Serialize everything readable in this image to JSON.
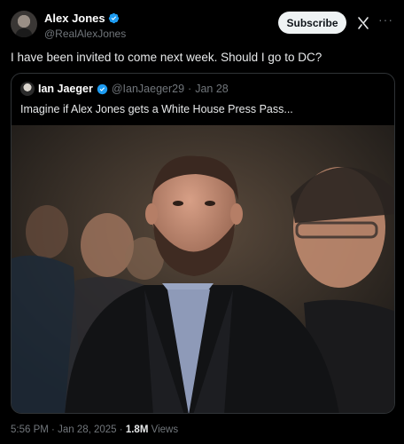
{
  "author": {
    "display_name": "Alex Jones",
    "handle": "@RealAlexJones"
  },
  "actions": {
    "subscribe_label": "Subscribe",
    "more_label": "···"
  },
  "tweet": {
    "text": "I have been invited to come next week. Should I go to DC?"
  },
  "quote": {
    "display_name": "Ian Jaeger",
    "handle": "@IanJaeger29",
    "separator": "·",
    "date": "Jan 28",
    "text": "Imagine if Alex Jones gets a White House Press Pass..."
  },
  "footer": {
    "time": "5:56 PM",
    "separator": "·",
    "date": "Jan 28, 2025",
    "separator2": "·",
    "views_count": "1.8M",
    "views_label": "Views"
  },
  "colors": {
    "verified": "#1d9bf0",
    "background": "#000000",
    "muted": "#71767b"
  }
}
